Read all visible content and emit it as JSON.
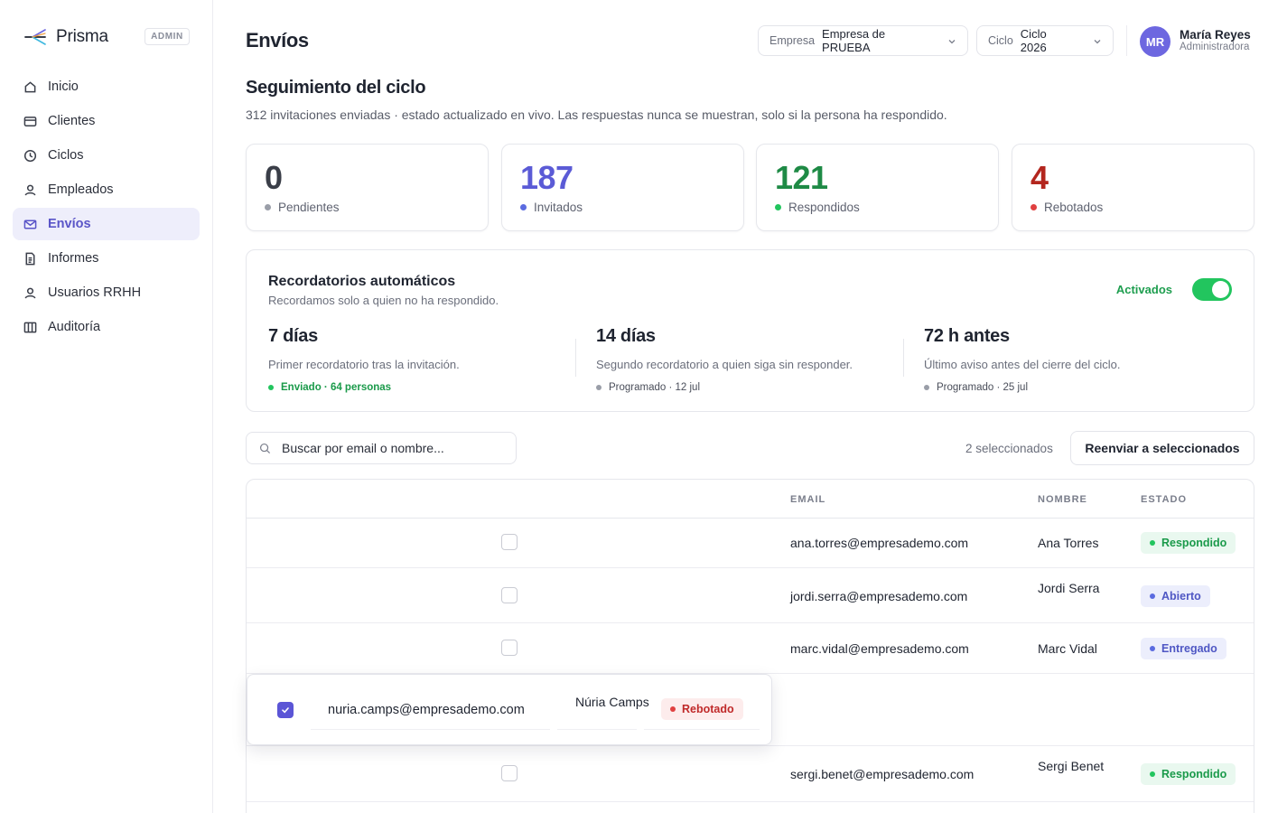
{
  "brand": {
    "name": "Prisma",
    "badge": "ADMIN"
  },
  "sidebar": {
    "items": [
      {
        "label": "Inicio",
        "icon": "home-icon"
      },
      {
        "label": "Clientes",
        "icon": "card-icon"
      },
      {
        "label": "Ciclos",
        "icon": "clock-icon"
      },
      {
        "label": "Empleados",
        "icon": "user-icon"
      },
      {
        "label": "Envíos",
        "icon": "mail-icon",
        "active": true
      },
      {
        "label": "Informes",
        "icon": "document-icon"
      },
      {
        "label": "Usuarios RRHH",
        "icon": "user-icon"
      },
      {
        "label": "Auditoría",
        "icon": "columns-icon"
      }
    ]
  },
  "header": {
    "title": "Envíos",
    "company": {
      "label": "Empresa",
      "value": "Empresa de PRUEBA"
    },
    "cycle": {
      "label": "Ciclo",
      "value": "Ciclo 2026"
    },
    "user": {
      "initials": "MR",
      "name": "María Reyes",
      "role": "Administradora"
    }
  },
  "section": {
    "title": "Seguimiento del ciclo",
    "subtitle": "312 invitaciones enviadas · estado actualizado en vivo. Las respuestas nunca se muestran, solo si la persona ha respondido."
  },
  "stats": [
    {
      "value": "0",
      "label": "Pendientes",
      "color": "#3a3e48",
      "dot": "#9a9ea8"
    },
    {
      "value": "187",
      "label": "Invitados",
      "color": "#5b5bd6",
      "dot": "#5b6be0"
    },
    {
      "value": "121",
      "label": "Respondidos",
      "color": "#1e8a45",
      "dot": "#22c55e"
    },
    {
      "value": "4",
      "label": "Rebotados",
      "color": "#b3261e",
      "dot": "#e04040"
    }
  ],
  "reminders": {
    "title": "Recordatorios automáticos",
    "subtitle": "Recordamos solo a quien no ha respondido.",
    "toggle_label": "Activados",
    "items": [
      {
        "title": "7 días",
        "desc": "Primer recordatorio tras la invitación.",
        "status": "Enviado · 64 personas",
        "status_color": "#1a9a4a",
        "dot": "#22c55e"
      },
      {
        "title": "14 días",
        "desc": "Segundo recordatorio a quien siga sin responder.",
        "status": "Programado · 12 jul",
        "status_color": "#4a4e5a",
        "dot": "#9a9ea8"
      },
      {
        "title": "72 h antes",
        "desc": "Último aviso antes del cierre del ciclo.",
        "status": "Programado · 25 jul",
        "status_color": "#4a4e5a",
        "dot": "#9a9ea8"
      }
    ]
  },
  "search": {
    "placeholder": "Buscar por email o nombre..."
  },
  "selection": {
    "count_label": "2 seleccionados",
    "resend_label": "Reenviar a seleccionados"
  },
  "table": {
    "columns": [
      "EMAIL",
      "NOMBRE",
      "ESTADO"
    ],
    "rows": [
      {
        "email": "ana.torres@empresademo.com",
        "name": "Ana Torres",
        "status": "Respondido",
        "tone": "green"
      },
      {
        "email": "jordi.serra@empresademo.com",
        "name": "Jordi Serra",
        "status": "Abierto",
        "tone": "blue"
      },
      {
        "email": "marc.vidal@empresademo.com",
        "name": "Marc Vidal",
        "status": "Entregado",
        "tone": "blue"
      },
      {
        "email": "sergi.benet@empresademo.com",
        "name": "Sergi Benet",
        "status": "Respondido",
        "tone": "green"
      }
    ],
    "dragged_row": {
      "email": "nuria.camps@empresademo.com",
      "name": "Núria Camps",
      "status": "Rebotado",
      "tone": "red",
      "checked": true
    }
  }
}
